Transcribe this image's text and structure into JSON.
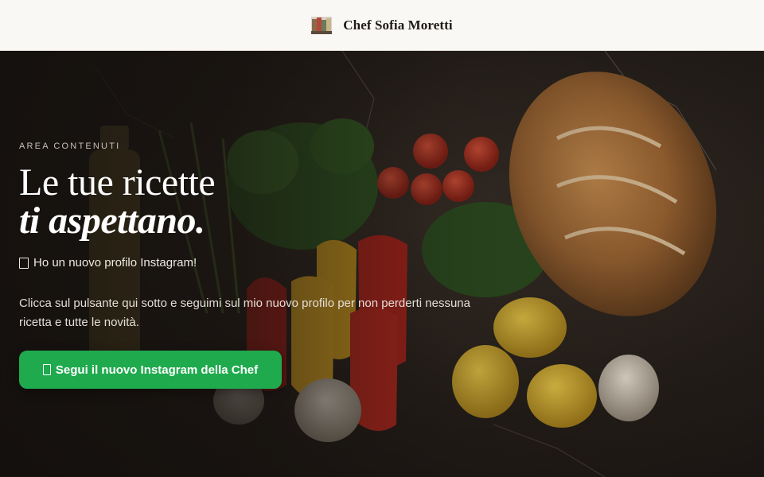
{
  "header": {
    "brand_name": "Chef Sofia Moretti",
    "logo_icon": "chef-photo-thumbnail"
  },
  "hero": {
    "eyebrow": "AREA CONTENUTI",
    "headline_line1": "Le tue ricette",
    "headline_line2": "ti aspettano.",
    "notice_icon": "box-glyph-icon",
    "notice": "Ho un nuovo profilo Instagram!",
    "description": "Clicca sul pulsante qui sotto e seguimi sul mio nuovo profilo per non perderti nessuna ricetta e tutte le novità.",
    "cta_icon": "box-glyph-icon",
    "cta_label": "Segui il nuovo Instagram della Chef",
    "background_image": "food-spread-bread-vegetables"
  },
  "colors": {
    "header_bg": "#faf8f4",
    "cta_green": "#1faa4e",
    "hero_dark": "#1c1714",
    "text_light": "#ffffff"
  }
}
